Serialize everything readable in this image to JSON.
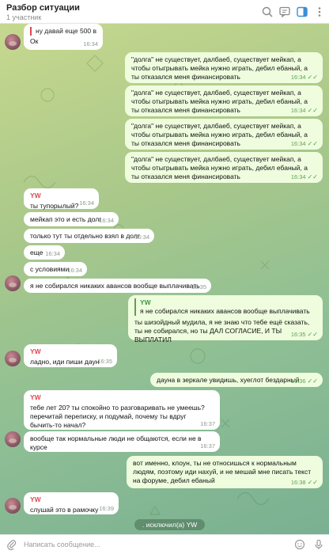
{
  "header": {
    "title": "Разбор ситуации",
    "subtitle": "1 участник"
  },
  "messages": [
    {
      "id": "m0",
      "quote": "ну давай еще 500 в до...",
      "text": "Ок",
      "time": "16:34"
    },
    {
      "id": "m1",
      "text": "\"долга\" не существует, далбаеб, существует мейкап, а чтобы отыгрывать мейка нужно играть, дебил ебаный, а ты отказался меня финансировать",
      "time": "16:34"
    },
    {
      "id": "m2",
      "text": "\"долга\" не существует, далбаеб, существует мейкап, а чтобы отыгрывать мейка нужно играть, дебил ебаный, а ты отказался меня финансировать",
      "time": "16:34"
    },
    {
      "id": "m3",
      "text": "\"долга\" не существует, далбаеб, существует мейкап, а чтобы отыгрывать мейка нужно играть, дебил ебаный, а ты отказался меня финансировать",
      "time": "16:34"
    },
    {
      "id": "m4",
      "text": "\"долга\" не существует, далбаеб, существует мейкап, а чтобы отыгрывать мейка нужно играть, дебил ебаный, а ты отказался меня финансировать",
      "time": "16:34"
    },
    {
      "id": "m5",
      "sender": "YW",
      "text": "ты тупорылый?",
      "time": "16:34"
    },
    {
      "id": "m6",
      "text": "мейкап это и есть долг",
      "time": "16:34"
    },
    {
      "id": "m7",
      "text": "только тут ты отдельно взял в долг",
      "time": "16:34"
    },
    {
      "id": "m8",
      "text": "еще",
      "time": "16:34"
    },
    {
      "id": "m9",
      "text": "с условиями",
      "time": "16:34"
    },
    {
      "id": "m10",
      "text": "я не собирался никаких авансов вообще выплачивать",
      "time": "16:35"
    },
    {
      "id": "m11",
      "quote_name": "YW",
      "quote": "я не собирался никаких авансов вообще выплачивать",
      "text": "ты шизойдный мудила, я не знаю что тебе ещё сказать, ты не собирался, но ты ДАЛ СОГЛАСИЕ, И ТЫ ВЫПЛАТИЛ",
      "time": "16:35"
    },
    {
      "id": "m12",
      "sender": "YW",
      "text": "ладно, иди пиши даун",
      "time": "16:35"
    },
    {
      "id": "m13",
      "text": "дауна в зеркале увидишь, хуеглот бездарный",
      "time": "16:36"
    },
    {
      "id": "m14",
      "sender": "YW",
      "text": "тебе лет 20? ты спокойно то разговаривать не умеешь? перечитай переписку, и подумай, почему ты вдруг бычить-то начал?",
      "time": "16:37"
    },
    {
      "id": "m15",
      "text": "вообще так нормальные люди не общаются, если не в курсе",
      "time": "16:37"
    },
    {
      "id": "m16",
      "text": "вот именно, клоун, ты не относишься к нормальным людям, поэтому иди нахуй, и не мешай мне писать текст на форуме, дебил ебаный",
      "time": "16:38"
    },
    {
      "id": "m17",
      "sender": "YW",
      "text": "слушай это в рамочку",
      "time": "16:39"
    }
  ],
  "service": ". исключил(а) YW",
  "composer": {
    "placeholder": "Написать сообщение..."
  },
  "icons": [
    "search-icon",
    "comments-icon",
    "sidebar-toggle-icon",
    "more-icon",
    "attach-icon",
    "sticker-icon",
    "microphone-icon"
  ],
  "colors": {
    "outgoing_bubble": "#effdde",
    "incoming_bubble": "#ffffff",
    "sender_name": "#e0484d",
    "accent": "#3a8fd8"
  }
}
